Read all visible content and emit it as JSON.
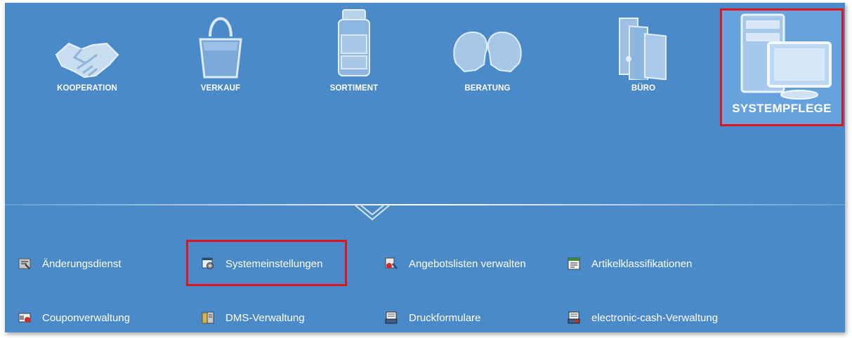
{
  "top_nav": [
    {
      "label": "KOOPERATION",
      "icon": "handshake-icon"
    },
    {
      "label": "VERKAUF",
      "icon": "shopping-bag-icon"
    },
    {
      "label": "SORTIMENT",
      "icon": "medicine-jar-icon"
    },
    {
      "label": "BERATUNG",
      "icon": "consultation-heads-icon"
    },
    {
      "label": "BÜRO",
      "icon": "binders-icon"
    },
    {
      "label": "SYSTEMPFLEGE",
      "icon": "computer-icon",
      "active": true
    }
  ],
  "sub_menu": [
    {
      "label": "Änderungsdienst",
      "icon": "aenderungsdienst-icon"
    },
    {
      "label": "Systemeinstellungen",
      "icon": "system-settings-icon",
      "highlighted": true
    },
    {
      "label": "Angebotslisten verwalten",
      "icon": "offer-lists-icon"
    },
    {
      "label": "Artikelklassifikationen",
      "icon": "article-classification-icon"
    },
    {
      "label": "Couponverwaltung",
      "icon": "coupon-icon"
    },
    {
      "label": "DMS-Verwaltung",
      "icon": "dms-icon"
    },
    {
      "label": "Druckformulare",
      "icon": "print-forms-icon"
    },
    {
      "label": "electronic-cash-Verwaltung",
      "icon": "ec-management-icon"
    }
  ],
  "colors": {
    "panel_background": "#4a8ac9",
    "active_tile": "#66a2dd",
    "highlight_border": "#e0141e",
    "text": "#ffffff"
  }
}
